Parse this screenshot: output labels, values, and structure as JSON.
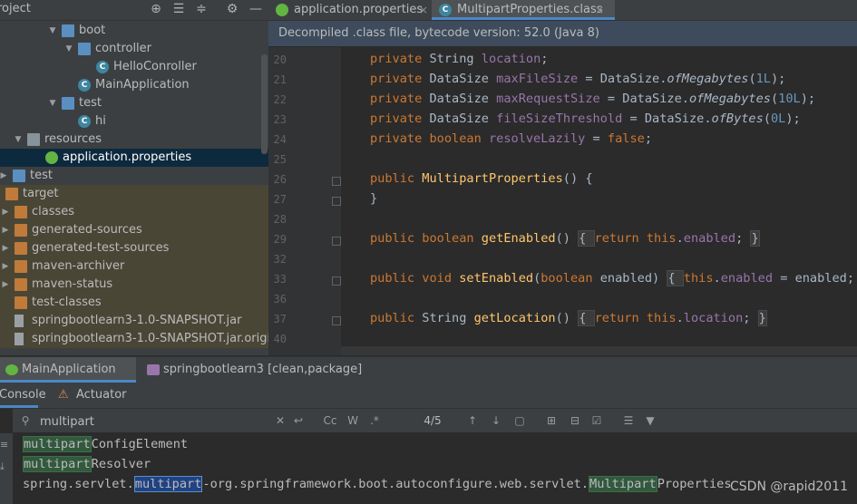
{
  "project": {
    "title": "roject",
    "tree": [
      {
        "label": "boot",
        "icon": "folder-icon",
        "expanded": true
      },
      {
        "label": "controller",
        "icon": "folder-icon",
        "expanded": true
      },
      {
        "label": "HelloConroller",
        "icon": "class-icon"
      },
      {
        "label": "MainApplication",
        "icon": "spring-class-icon"
      },
      {
        "label": "test",
        "icon": "folder-icon",
        "expanded": true
      },
      {
        "label": "hi",
        "icon": "class-icon"
      },
      {
        "label": "resources",
        "icon": "resources-folder-icon",
        "expanded": true
      },
      {
        "label": "application.properties",
        "icon": "spring-properties-icon",
        "selected": true
      },
      {
        "label": "test",
        "icon": "folder-icon",
        "expanded": false
      },
      {
        "label": "target",
        "icon": "orange-folder-icon"
      },
      {
        "label": "classes",
        "icon": "orange-folder-icon",
        "expanded": false
      },
      {
        "label": "generated-sources",
        "icon": "orange-folder-icon",
        "expanded": false
      },
      {
        "label": "generated-test-sources",
        "icon": "orange-folder-icon",
        "expanded": false
      },
      {
        "label": "maven-archiver",
        "icon": "orange-folder-icon",
        "expanded": false
      },
      {
        "label": "maven-status",
        "icon": "orange-folder-icon",
        "expanded": false
      },
      {
        "label": "test-classes",
        "icon": "orange-folder-icon"
      },
      {
        "label": "springbootlearn3-1.0-SNAPSHOT.jar",
        "icon": "jar-icon"
      },
      {
        "label": "springbootlearn3-1.0-SNAPSHOT.jar.origin",
        "icon": "jar-icon"
      }
    ]
  },
  "editor": {
    "tabs": [
      {
        "label": "application.properties",
        "icon": "spring-properties-icon",
        "active": false
      },
      {
        "label": "MultipartProperties.class",
        "icon": "class-icon",
        "active": true
      }
    ],
    "tab_close": "×",
    "banner": "Decompiled .class file, bytecode version: 52.0 (Java 8)",
    "lines": [
      {
        "n": "20",
        "tokens": [
          [
            "kw",
            "private "
          ],
          [
            "",
            "String "
          ],
          [
            "fld",
            "location"
          ],
          [
            "",
            ";"
          ]
        ]
      },
      {
        "n": "21",
        "tokens": [
          [
            "kw",
            "private "
          ],
          [
            "",
            "DataSize "
          ],
          [
            "fld",
            "maxFileSize"
          ],
          [
            "",
            " = DataSize."
          ],
          [
            "st",
            "ofMegabytes"
          ],
          [
            "",
            "("
          ],
          [
            "num",
            "1L"
          ],
          [
            "",
            ");"
          ]
        ]
      },
      {
        "n": "22",
        "tokens": [
          [
            "kw",
            "private "
          ],
          [
            "",
            "DataSize "
          ],
          [
            "fld",
            "maxRequestSize"
          ],
          [
            "",
            " = DataSize."
          ],
          [
            "st",
            "ofMegabytes"
          ],
          [
            "",
            "("
          ],
          [
            "num",
            "10L"
          ],
          [
            "",
            ");"
          ]
        ]
      },
      {
        "n": "23",
        "tokens": [
          [
            "kw",
            "private "
          ],
          [
            "",
            "DataSize "
          ],
          [
            "fld",
            "fileSizeThreshold"
          ],
          [
            "",
            " = DataSize."
          ],
          [
            "st",
            "ofBytes"
          ],
          [
            "",
            "("
          ],
          [
            "num",
            "0L"
          ],
          [
            "",
            ");"
          ]
        ]
      },
      {
        "n": "24",
        "tokens": [
          [
            "kw",
            "private boolean "
          ],
          [
            "fld",
            "resolveLazily"
          ],
          [
            "",
            " = "
          ],
          [
            "kw",
            "false"
          ],
          [
            "",
            ";"
          ]
        ]
      },
      {
        "n": "25",
        "tokens": []
      },
      {
        "n": "26",
        "tokens": [
          [
            "kw",
            "public "
          ],
          [
            "meth",
            "MultipartProperties"
          ],
          [
            "",
            "() {"
          ]
        ]
      },
      {
        "n": "27",
        "tokens": [
          [
            "",
            "}"
          ]
        ]
      },
      {
        "n": "28",
        "tokens": []
      },
      {
        "n": "29",
        "tokens": [
          [
            "kw",
            "public boolean "
          ],
          [
            "meth",
            "getEnabled"
          ],
          [
            "",
            "() "
          ],
          [
            "fb",
            "{ "
          ],
          [
            "kw",
            "return this"
          ],
          [
            "",
            "."
          ],
          [
            "fld",
            "enabled"
          ],
          [
            "",
            "; "
          ],
          [
            "fb",
            "}"
          ]
        ]
      },
      {
        "n": "32",
        "tokens": []
      },
      {
        "n": "33",
        "tokens": [
          [
            "kw",
            "public void "
          ],
          [
            "meth",
            "setEnabled"
          ],
          [
            "",
            "("
          ],
          [
            "kw",
            "boolean "
          ],
          [
            "",
            "enabled) "
          ],
          [
            "fb",
            "{ "
          ],
          [
            "kw",
            "this"
          ],
          [
            "",
            "."
          ],
          [
            "fld",
            "enabled"
          ],
          [
            "",
            " = enabled; "
          ],
          [
            "fb",
            "}"
          ]
        ]
      },
      {
        "n": "36",
        "tokens": []
      },
      {
        "n": "37",
        "tokens": [
          [
            "kw",
            "public "
          ],
          [
            "",
            "String "
          ],
          [
            "meth",
            "getLocation"
          ],
          [
            "",
            "() "
          ],
          [
            "fb",
            "{ "
          ],
          [
            "kw",
            "return this"
          ],
          [
            "",
            "."
          ],
          [
            "fld",
            "location"
          ],
          [
            "",
            "; "
          ],
          [
            "fb",
            "}"
          ]
        ]
      },
      {
        "n": "40",
        "tokens": []
      }
    ]
  },
  "run": {
    "tabs": [
      {
        "label": "MainApplication",
        "icon": "spring-run-icon",
        "active": true
      },
      {
        "label": "springbootlearn3 [clean,package]",
        "icon": "maven-run-icon",
        "active": false
      }
    ],
    "console_tabs": [
      {
        "label": "Console",
        "active": true
      },
      {
        "label": "Actuator",
        "active": false
      }
    ]
  },
  "search": {
    "query": "multipart",
    "match_count": "4/5",
    "case_label": "Cc",
    "words_label": "W",
    "regex_label": ".*"
  },
  "console": {
    "lines": [
      {
        "prefix": "",
        "match": "multipart",
        "rest": "ConfigElement",
        "kind": "plain"
      },
      {
        "prefix": "",
        "match": "multipart",
        "rest": "Resolver",
        "kind": "plain"
      },
      {
        "prefix": "spring.servlet.",
        "match": "multipart",
        "rest": "-org.springframework.boot.autoconfigure.web.servlet.",
        "match2": "Multipart",
        "rest2": "Properties",
        "kind": "current"
      }
    ]
  },
  "watermark": "CSDN @rapid2011",
  "colors": {
    "keyword": "#cc7832",
    "field": "#9876aa",
    "number": "#6897bb",
    "method": "#ffc66d",
    "accent": "#4a88c7",
    "selection": "#0d293e"
  }
}
